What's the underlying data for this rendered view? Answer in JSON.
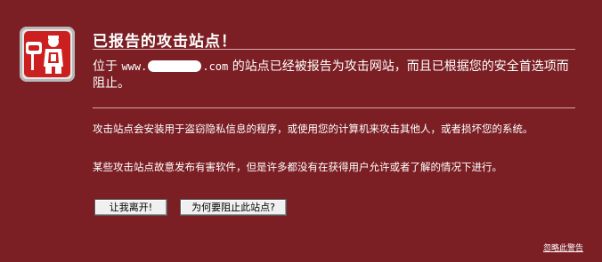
{
  "dialog": {
    "title": "已报告的攻击站点！",
    "lead": {
      "prefix": "位于 ",
      "domain_start": "www.",
      "domain_end": ".com",
      "suffix": " 的站点已经被报告为攻击网站，而且已根据您的安全首选项而阻止。"
    },
    "paragraph1": "攻击站点会安装用于盗窃隐私信息的程序，或使用您的计算机来攻击其他人，或者损坏您的系统。",
    "paragraph2": "某些攻击站点故意发布有害软件，但是许多都没有在获得用户允许或者了解的情况下进行。",
    "buttons": {
      "get_me_out": "让我离开!",
      "why_blocked": "为何要阻止此站点?"
    },
    "ignore_link": "忽略此警告"
  },
  "icon": {
    "name": "attack-site-warning-icon",
    "color": "#cc1f1f"
  },
  "colors": {
    "background": "#7b1f24",
    "text": "#ffffff",
    "button_bg": "#f0f0f0"
  }
}
